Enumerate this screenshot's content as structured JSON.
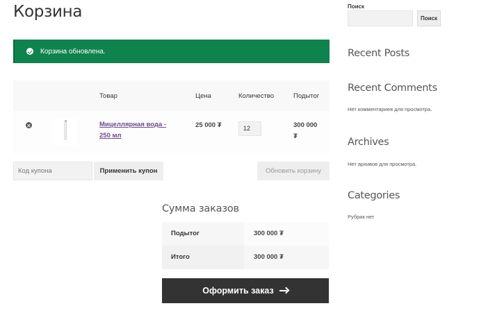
{
  "page": {
    "title": "Корзина"
  },
  "notice": {
    "message": "Корзина обновлена."
  },
  "cart": {
    "headers": {
      "product": "Товар",
      "price": "Цена",
      "quantity": "Количество",
      "subtotal": "Подытог"
    },
    "items": [
      {
        "name": "Мицеллярная вода - 250 мл",
        "price": "25 000 ₮",
        "quantity": "12",
        "subtotal": "300 000 ₮"
      }
    ],
    "coupon_placeholder": "Код купона",
    "apply_coupon_label": "Применить купон",
    "update_cart_label": "Обновить корзину"
  },
  "totals": {
    "title": "Сумма заказов",
    "rows": [
      {
        "label": "Подытог",
        "value": "300 000 ₮"
      },
      {
        "label": "Итого",
        "value": "300 000 ₮"
      }
    ],
    "checkout_label": "Оформить заказ"
  },
  "sidebar": {
    "search_label": "Поиск",
    "search_button": "Поиск",
    "widgets": [
      {
        "title": "Recent Posts",
        "text": ""
      },
      {
        "title": "Recent Comments",
        "text": "Нет комментариев для просмотра."
      },
      {
        "title": "Archives",
        "text": "Нет архивов для просмотра."
      },
      {
        "title": "Categories",
        "text": "Рубрик нет"
      }
    ]
  },
  "colors": {
    "notice_bg": "#0f834d",
    "checkout_bg": "#333333",
    "link": "#6a4c8f"
  }
}
